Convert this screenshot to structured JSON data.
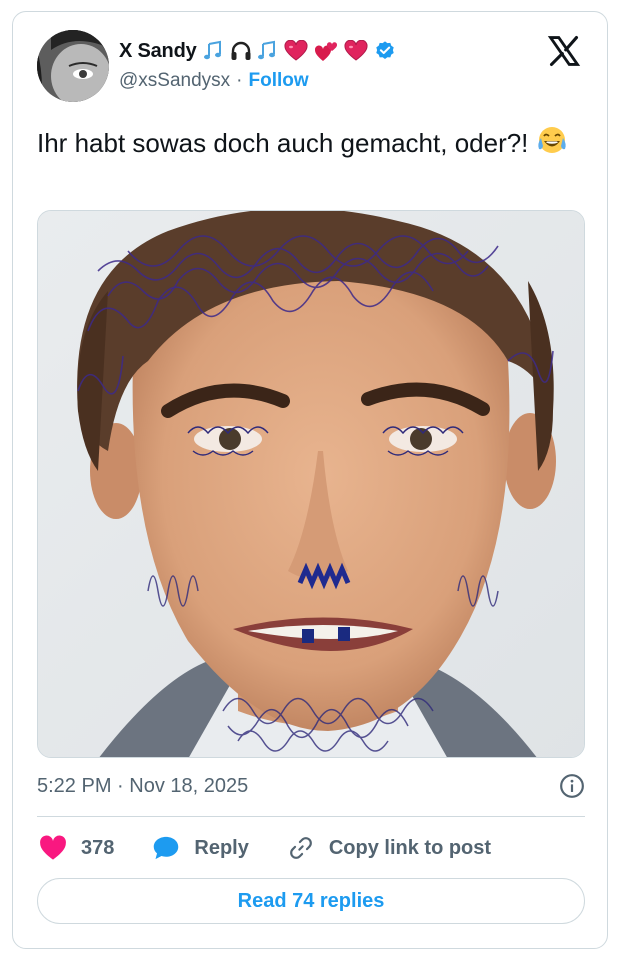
{
  "author": {
    "display_name": "X Sandy",
    "handle": "@xsSandysx",
    "separator": "·",
    "follow_label": "Follow"
  },
  "tweet": {
    "text": "Ihr habt sowas doch auch gemacht, oder?!",
    "timestamp": "5:22 PM · Nov 18, 2025"
  },
  "actions": {
    "likes": "378",
    "reply_label": "Reply",
    "copy_link_label": "Copy link to post"
  },
  "read_replies_label": "Read 74 replies",
  "colors": {
    "accent": "#1d9bf0",
    "like": "#f91880",
    "muted": "#536471",
    "border": "#cfd9de",
    "ink": "#0f1419"
  },
  "icons": [
    "x-logo-icon",
    "verified-badge-icon",
    "music-note-icon",
    "headphones-icon",
    "heart-icon",
    "info-icon",
    "reply-bubble-icon",
    "link-icon",
    "laughing-tears-emoji"
  ]
}
